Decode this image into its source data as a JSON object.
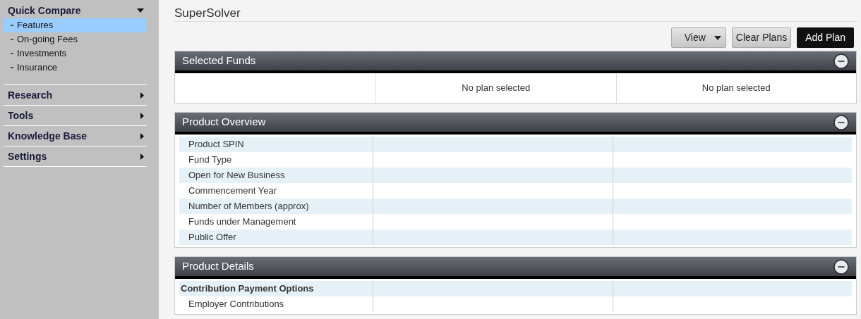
{
  "sidebar": {
    "groups": [
      {
        "label": "Quick Compare",
        "expanded": true,
        "items": [
          {
            "label": "Features",
            "selected": true
          },
          {
            "label": "On-going Fees",
            "selected": false
          },
          {
            "label": "Investments",
            "selected": false
          },
          {
            "label": "Insurance",
            "selected": false
          }
        ]
      },
      {
        "label": "Research",
        "expanded": false
      },
      {
        "label": "Tools",
        "expanded": false
      },
      {
        "label": "Knowledge Base",
        "expanded": false
      },
      {
        "label": "Settings",
        "expanded": false
      }
    ]
  },
  "page_title": "SuperSolver",
  "toolbar": {
    "view_button": "View",
    "clear_button": "Clear Plans",
    "add_button": "Add Plan"
  },
  "selected_funds": {
    "title": "Selected Funds",
    "plans": [
      "No plan selected",
      "No plan selected"
    ]
  },
  "product_overview": {
    "title": "Product Overview",
    "rows": [
      {
        "label": "Product SPIN"
      },
      {
        "label": "Fund Type"
      },
      {
        "label": "Open for New Business"
      },
      {
        "label": "Commencement Year"
      },
      {
        "label": "Number of Members (approx)"
      },
      {
        "label": "Funds under Management"
      },
      {
        "label": "Public Offer"
      }
    ]
  },
  "product_details": {
    "title": "Product Details",
    "rows": [
      {
        "label": "Contribution Payment Options",
        "kind": "heading"
      },
      {
        "label": "Employer Contributions",
        "kind": "row"
      }
    ]
  }
}
